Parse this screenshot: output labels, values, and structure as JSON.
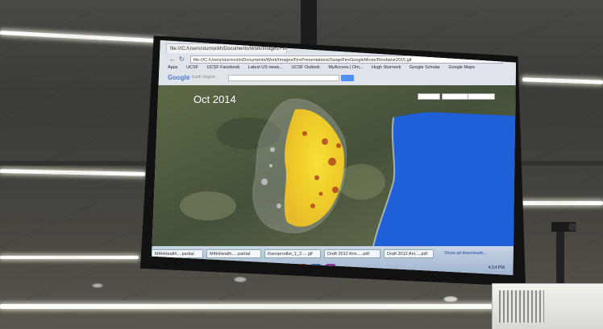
{
  "monitor": {
    "browser": {
      "tab_title": "file:///C:/Users/sturnockh/Documents/Work/Images/Fire/Presentations",
      "address": "file:///C:/Users/sturnockh/Documents/Work/Images/FirePresentations/Swap/FireGoogleMovie/Rissbane2015.gif",
      "bookmarks": [
        "Apps",
        "UCSF",
        "UCSF Facebook",
        "Latest US news...",
        "UCSF Outlook",
        "MyAccess | Om...",
        "Hugh Sturnock",
        "Google Scholar",
        "Google Maps"
      ],
      "search_brand": "Google",
      "search_sub": "Earth Engine"
    },
    "map": {
      "title": "Oct 2014"
    },
    "taskbar": {
      "windows": [
        "M4HHealth....partial",
        "M4HHealth.....partial",
        "Ranoprodke_1_2.... gif",
        "Draft 2012 Ann.....pdf",
        "Draft 2012 Ani.....pdf"
      ],
      "show_downloads": "Show all downloads...",
      "clock": "4:14 PM"
    }
  },
  "colors": {
    "fire_yellow": "#f2d22a",
    "fire_red": "#a8341f",
    "ocean": "#1e5fd6",
    "land": "#4d5a3c"
  }
}
